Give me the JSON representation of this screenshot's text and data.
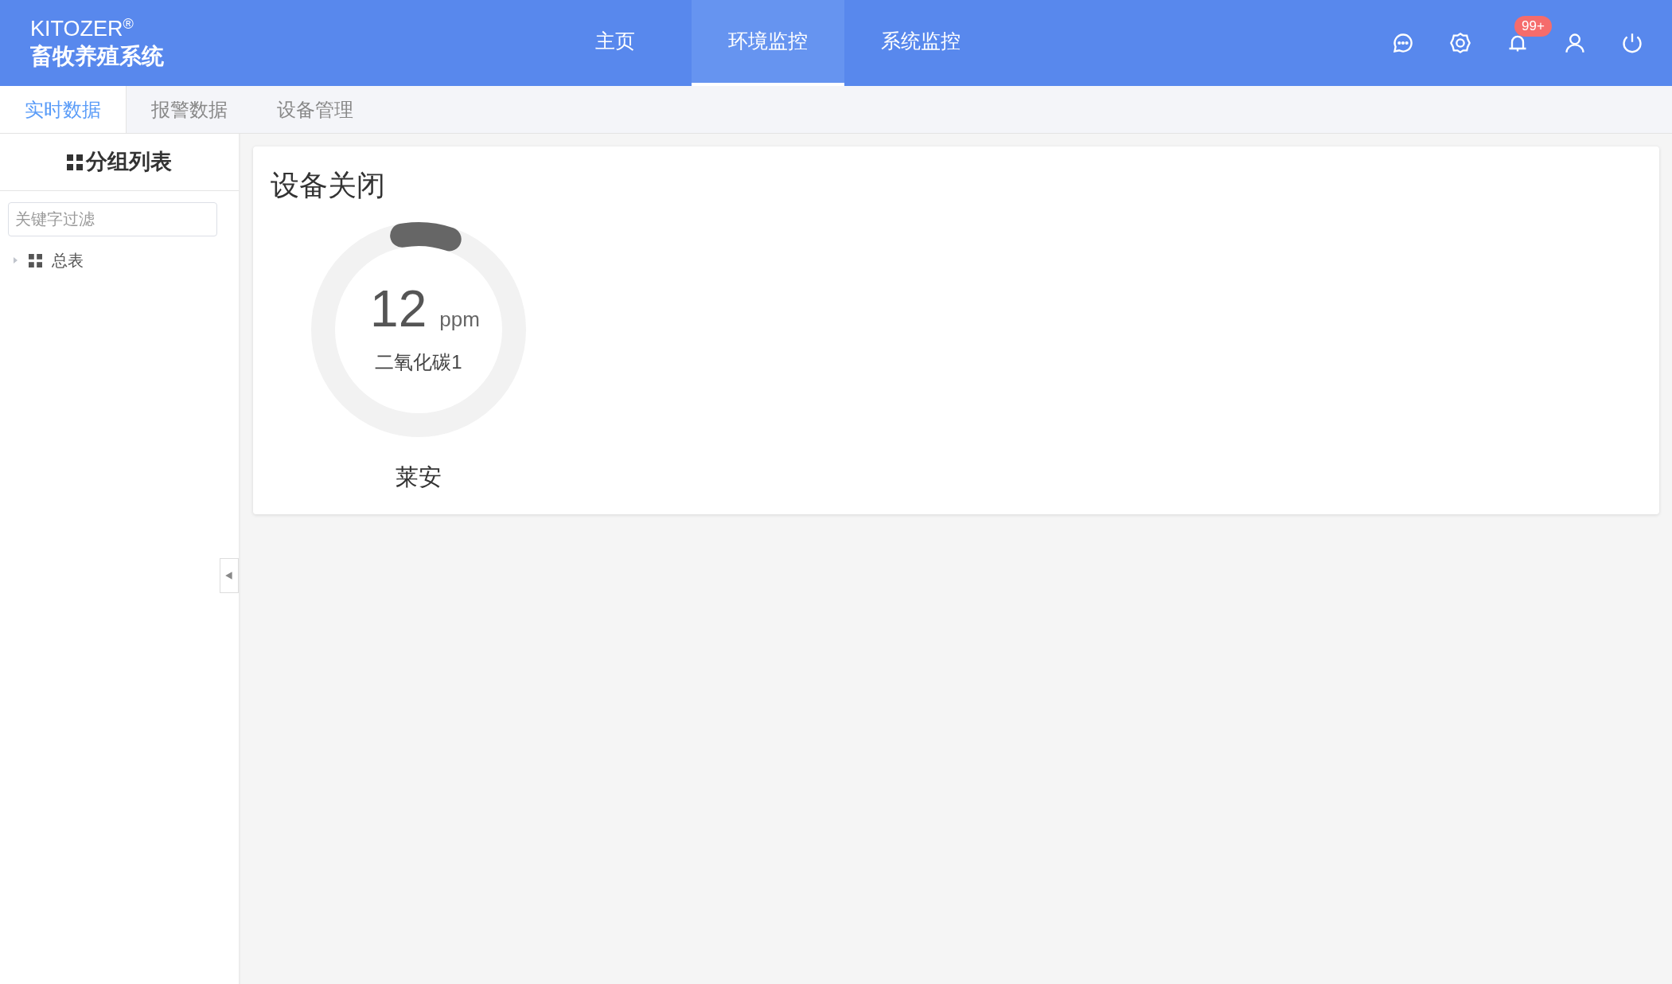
{
  "brand": {
    "name": "KITOZER",
    "mark": "®",
    "subtitle": "畜牧养殖系统"
  },
  "nav": [
    {
      "label": "主页",
      "selected": false
    },
    {
      "label": "环境监控",
      "selected": true
    },
    {
      "label": "系统监控",
      "selected": false
    }
  ],
  "toolbar": {
    "notification_badge": "99+"
  },
  "subtabs": [
    {
      "label": "实时数据",
      "selected": true
    },
    {
      "label": "报警数据",
      "selected": false
    },
    {
      "label": "设备管理",
      "selected": false
    }
  ],
  "sidebar": {
    "title": "分组列表",
    "filter": {
      "placeholder": "关键字过滤"
    },
    "tree": [
      {
        "label": "总表",
        "expanded": false
      }
    ]
  },
  "card": {
    "title": "设备关闭",
    "gauges": [
      {
        "value": "12",
        "unit": "ppm",
        "sensor": "二氧化碳1",
        "level": 0.08,
        "location": "莱安"
      }
    ]
  }
}
